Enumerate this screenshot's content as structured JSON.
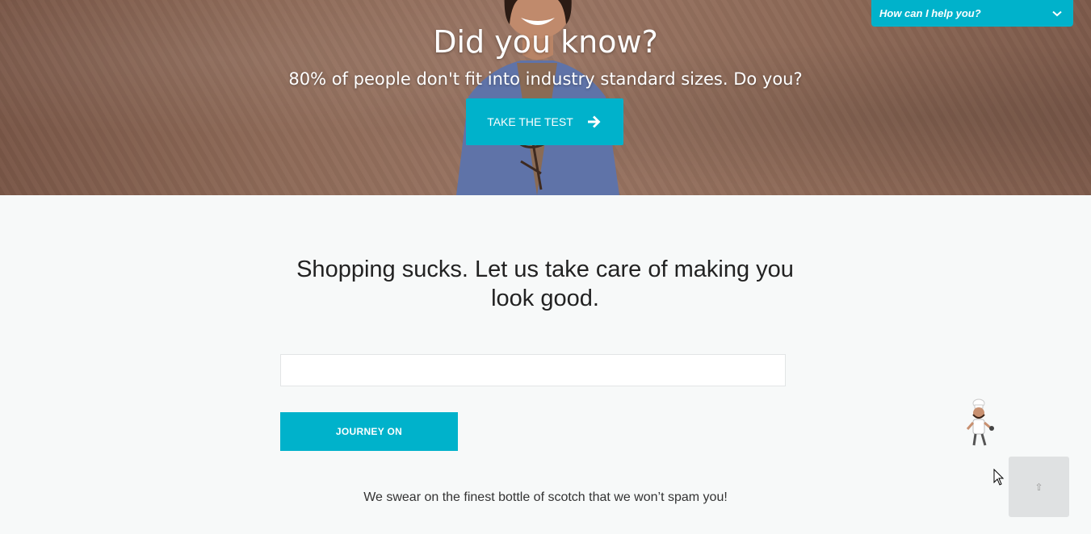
{
  "hero": {
    "title": "Did you know?",
    "subtitle": "80% of people don't fit into industry standard sizes. Do you?",
    "cta_label": "TAKE THE TEST",
    "cta_icon": "arrow-right-icon"
  },
  "chat_widget": {
    "label": "How can I help you?",
    "icon": "chevron-down-icon"
  },
  "signup": {
    "heading": "Shopping sucks. Let us take care of making you look good.",
    "email_value": "",
    "button_label": "JOURNEY ON",
    "note": "We swear on the finest bottle of scotch that we won’t spam you!"
  },
  "back_to_top": {
    "label": "⇧",
    "icon": "arrow-up-icon"
  },
  "colors": {
    "accent": "#00b2cb",
    "page_bg": "#f7f9f9"
  }
}
